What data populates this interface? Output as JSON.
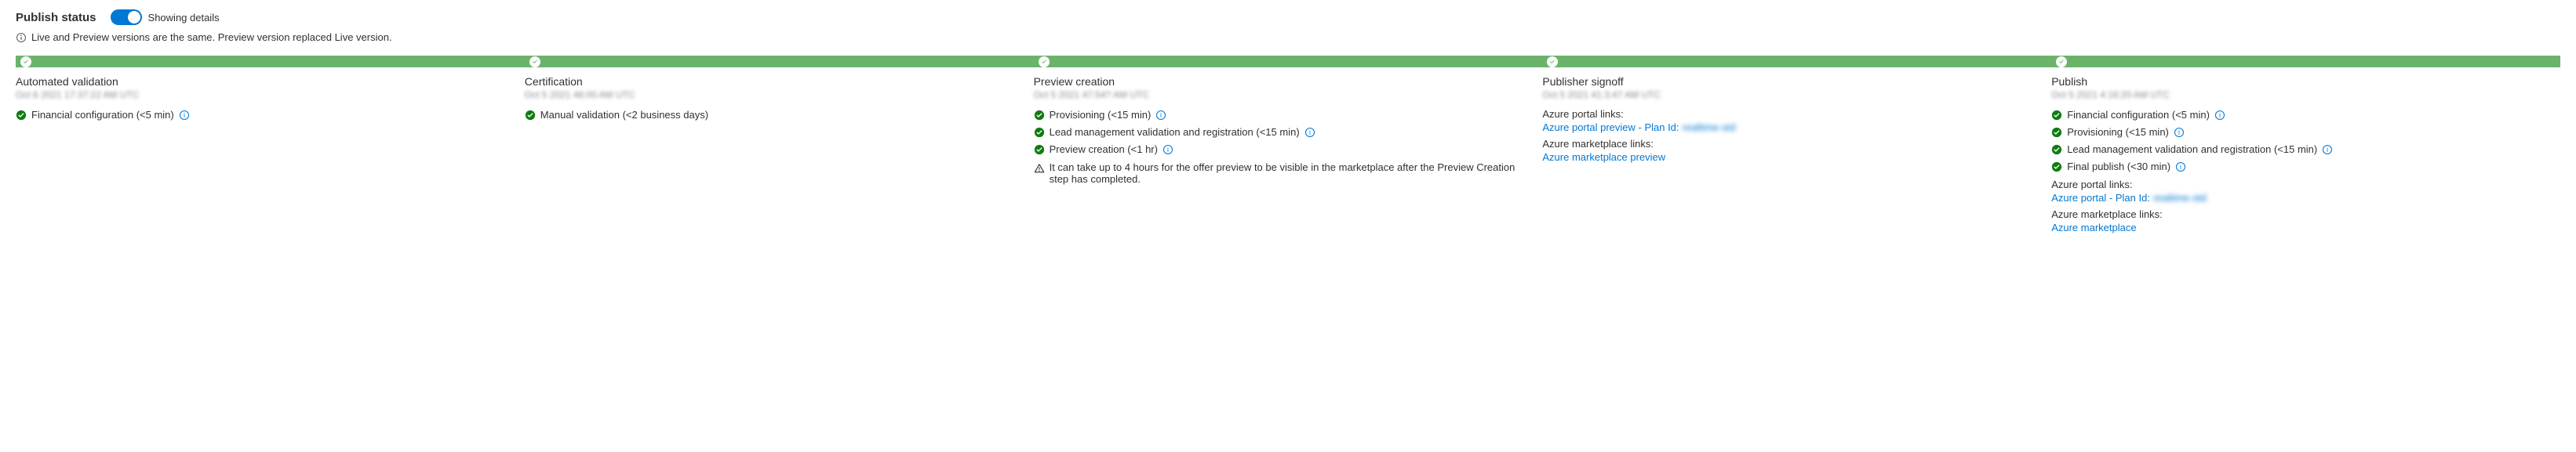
{
  "header": {
    "title": "Publish status",
    "toggle_label": "Showing details",
    "note": "Live and Preview versions are the same. Preview version replaced Live version."
  },
  "stages": {
    "automated_validation": {
      "title": "Automated validation",
      "date": "Oct 6 2021 17:37:22 AM UTC",
      "substeps": {
        "financial": "Financial configuration (<5 min)"
      }
    },
    "certification": {
      "title": "Certification",
      "date": "Oct 5 2021 46:00 AM UTC",
      "substeps": {
        "manual": "Manual validation (<2 business days)"
      }
    },
    "preview_creation": {
      "title": "Preview creation",
      "date": "Oct 5 2021 47:54? AM UTC",
      "substeps": {
        "provisioning": "Provisioning (<15 min)",
        "lead": "Lead management validation and registration (<15 min)",
        "preview": "Preview creation (<1 hr)"
      },
      "warning": "It can take up to 4 hours for the offer preview to be visible in the marketplace after the Preview Creation step has completed."
    },
    "publisher_signoff": {
      "title": "Publisher signoff",
      "date": "Oct 5 2021 41:3:47 AM UTC",
      "portal_links_label": "Azure portal links:",
      "portal_preview_link": "Azure portal preview - Plan Id:",
      "portal_preview_id": "realtime-std",
      "marketplace_links_label": "Azure marketplace links:",
      "marketplace_preview_link": "Azure marketplace preview"
    },
    "publish": {
      "title": "Publish",
      "date": "Oct 5 2021 4:16:20 AM UTC",
      "substeps": {
        "financial": "Financial configuration (<5 min)",
        "provisioning": "Provisioning (<15 min)",
        "lead": "Lead management validation and registration (<15 min)",
        "final": "Final publish (<30 min)"
      },
      "portal_links_label": "Azure portal links:",
      "portal_link": "Azure portal - Plan Id:",
      "portal_id": "realtime-std",
      "marketplace_links_label": "Azure marketplace links:",
      "marketplace_link": "Azure marketplace"
    }
  }
}
